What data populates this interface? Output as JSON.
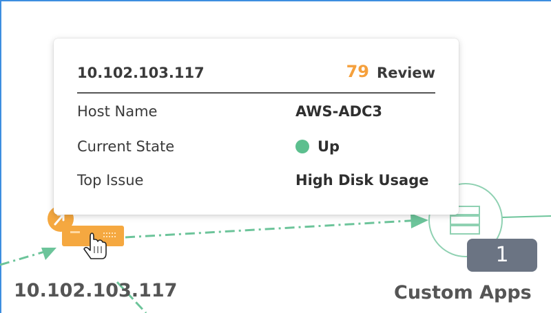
{
  "tooltip": {
    "ip": "10.102.103.117",
    "score": "79",
    "status": "Review",
    "rows": [
      {
        "label": "Host Name",
        "value": "AWS-ADC3"
      },
      {
        "label": "Current State",
        "value": "Up"
      },
      {
        "label": "Top Issue",
        "value": "High Disk Usage"
      }
    ]
  },
  "nodes": {
    "adc_label": "10.102.103.117",
    "apps_label": "Custom Apps",
    "apps_count": "1"
  },
  "colors": {
    "accent_border": "#3d8ee0",
    "score": "#f5a03c",
    "state_up": "#5cbf8e",
    "link": "#6cc49a",
    "device": "#f5a840",
    "badge": "#6b7483"
  },
  "icons": [
    "alert-icon",
    "adc-device-icon",
    "hand-pointer-icon",
    "app-server-icon"
  ]
}
